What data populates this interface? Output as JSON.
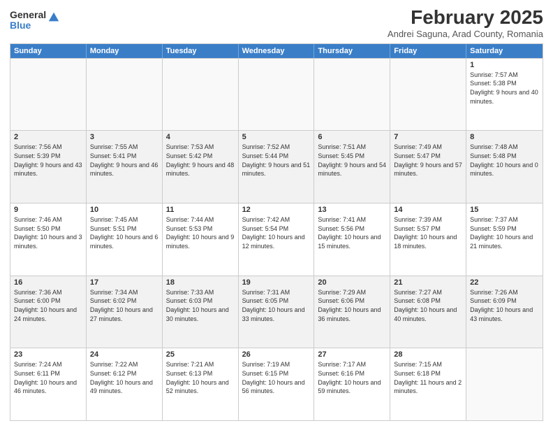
{
  "logo": {
    "general": "General",
    "blue": "Blue"
  },
  "header": {
    "title": "February 2025",
    "subtitle": "Andrei Saguna, Arad County, Romania"
  },
  "days": [
    "Sunday",
    "Monday",
    "Tuesday",
    "Wednesday",
    "Thursday",
    "Friday",
    "Saturday"
  ],
  "weeks": [
    [
      {
        "day": "",
        "text": ""
      },
      {
        "day": "",
        "text": ""
      },
      {
        "day": "",
        "text": ""
      },
      {
        "day": "",
        "text": ""
      },
      {
        "day": "",
        "text": ""
      },
      {
        "day": "",
        "text": ""
      },
      {
        "day": "1",
        "text": "Sunrise: 7:57 AM\nSunset: 5:38 PM\nDaylight: 9 hours and 40 minutes."
      }
    ],
    [
      {
        "day": "2",
        "text": "Sunrise: 7:56 AM\nSunset: 5:39 PM\nDaylight: 9 hours and 43 minutes."
      },
      {
        "day": "3",
        "text": "Sunrise: 7:55 AM\nSunset: 5:41 PM\nDaylight: 9 hours and 46 minutes."
      },
      {
        "day": "4",
        "text": "Sunrise: 7:53 AM\nSunset: 5:42 PM\nDaylight: 9 hours and 48 minutes."
      },
      {
        "day": "5",
        "text": "Sunrise: 7:52 AM\nSunset: 5:44 PM\nDaylight: 9 hours and 51 minutes."
      },
      {
        "day": "6",
        "text": "Sunrise: 7:51 AM\nSunset: 5:45 PM\nDaylight: 9 hours and 54 minutes."
      },
      {
        "day": "7",
        "text": "Sunrise: 7:49 AM\nSunset: 5:47 PM\nDaylight: 9 hours and 57 minutes."
      },
      {
        "day": "8",
        "text": "Sunrise: 7:48 AM\nSunset: 5:48 PM\nDaylight: 10 hours and 0 minutes."
      }
    ],
    [
      {
        "day": "9",
        "text": "Sunrise: 7:46 AM\nSunset: 5:50 PM\nDaylight: 10 hours and 3 minutes."
      },
      {
        "day": "10",
        "text": "Sunrise: 7:45 AM\nSunset: 5:51 PM\nDaylight: 10 hours and 6 minutes."
      },
      {
        "day": "11",
        "text": "Sunrise: 7:44 AM\nSunset: 5:53 PM\nDaylight: 10 hours and 9 minutes."
      },
      {
        "day": "12",
        "text": "Sunrise: 7:42 AM\nSunset: 5:54 PM\nDaylight: 10 hours and 12 minutes."
      },
      {
        "day": "13",
        "text": "Sunrise: 7:41 AM\nSunset: 5:56 PM\nDaylight: 10 hours and 15 minutes."
      },
      {
        "day": "14",
        "text": "Sunrise: 7:39 AM\nSunset: 5:57 PM\nDaylight: 10 hours and 18 minutes."
      },
      {
        "day": "15",
        "text": "Sunrise: 7:37 AM\nSunset: 5:59 PM\nDaylight: 10 hours and 21 minutes."
      }
    ],
    [
      {
        "day": "16",
        "text": "Sunrise: 7:36 AM\nSunset: 6:00 PM\nDaylight: 10 hours and 24 minutes."
      },
      {
        "day": "17",
        "text": "Sunrise: 7:34 AM\nSunset: 6:02 PM\nDaylight: 10 hours and 27 minutes."
      },
      {
        "day": "18",
        "text": "Sunrise: 7:33 AM\nSunset: 6:03 PM\nDaylight: 10 hours and 30 minutes."
      },
      {
        "day": "19",
        "text": "Sunrise: 7:31 AM\nSunset: 6:05 PM\nDaylight: 10 hours and 33 minutes."
      },
      {
        "day": "20",
        "text": "Sunrise: 7:29 AM\nSunset: 6:06 PM\nDaylight: 10 hours and 36 minutes."
      },
      {
        "day": "21",
        "text": "Sunrise: 7:27 AM\nSunset: 6:08 PM\nDaylight: 10 hours and 40 minutes."
      },
      {
        "day": "22",
        "text": "Sunrise: 7:26 AM\nSunset: 6:09 PM\nDaylight: 10 hours and 43 minutes."
      }
    ],
    [
      {
        "day": "23",
        "text": "Sunrise: 7:24 AM\nSunset: 6:11 PM\nDaylight: 10 hours and 46 minutes."
      },
      {
        "day": "24",
        "text": "Sunrise: 7:22 AM\nSunset: 6:12 PM\nDaylight: 10 hours and 49 minutes."
      },
      {
        "day": "25",
        "text": "Sunrise: 7:21 AM\nSunset: 6:13 PM\nDaylight: 10 hours and 52 minutes."
      },
      {
        "day": "26",
        "text": "Sunrise: 7:19 AM\nSunset: 6:15 PM\nDaylight: 10 hours and 56 minutes."
      },
      {
        "day": "27",
        "text": "Sunrise: 7:17 AM\nSunset: 6:16 PM\nDaylight: 10 hours and 59 minutes."
      },
      {
        "day": "28",
        "text": "Sunrise: 7:15 AM\nSunset: 6:18 PM\nDaylight: 11 hours and 2 minutes."
      },
      {
        "day": "",
        "text": ""
      }
    ]
  ]
}
